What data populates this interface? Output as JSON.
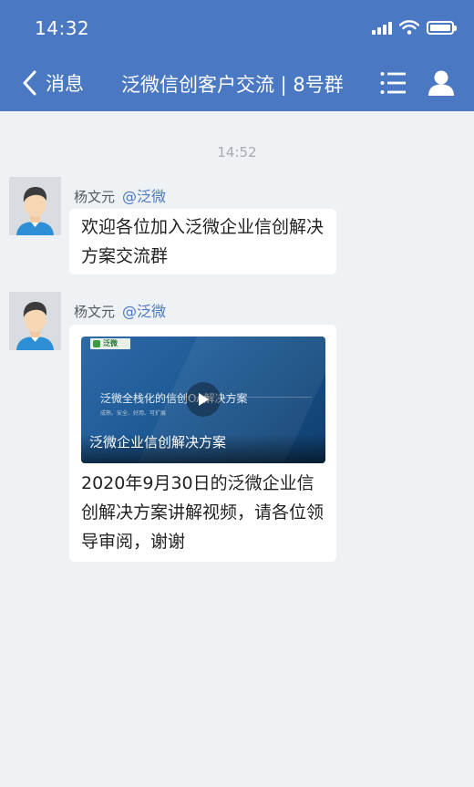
{
  "status_bar": {
    "time": "14:32"
  },
  "nav": {
    "back_label": "消息",
    "title": "泛微信创客户交流 | 8号群"
  },
  "chat": {
    "time_separator": "14:52",
    "messages": [
      {
        "sender": "杨文元",
        "mention": "@泛微",
        "text": "欢迎各位加入泛微企业信创解决方案交流群"
      },
      {
        "sender": "杨文元",
        "mention": "@泛微",
        "video": {
          "logo_text": "泛微",
          "slide_title": "泛微全栈化的信创OA解决方案",
          "slide_subtitle": "成熟、安全、好用、可扩展",
          "caption": "泛微企业信创解决方案"
        },
        "text": "2020年9月30日的泛微企业信创解决方案讲解视频，请各位领导审阅，谢谢"
      }
    ]
  },
  "colors": {
    "header_bg": "#4a78c2",
    "chat_bg": "#eff2f5",
    "mention": "#4a78c2"
  }
}
